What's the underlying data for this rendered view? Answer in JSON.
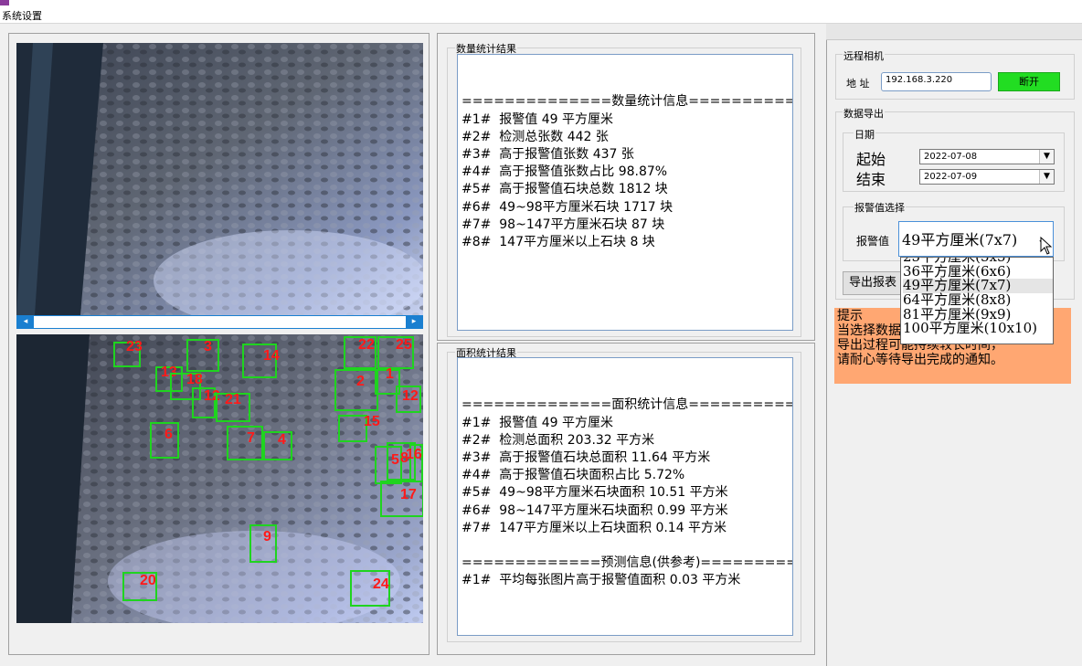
{
  "menu": {
    "settings": "系统设置"
  },
  "count_panel": {
    "title": "数量统计结果",
    "lines": [
      "==============数量统计信息==============",
      "#1#  报警值 49 平方厘米",
      "#2#  检测总张数 442 张",
      "#3#  高于报警值张数 437 张",
      "#4#  高于报警值张数占比 98.87%",
      "#5#  高于报警值石块总数 1812 块",
      "#6#  49~98平方厘米石块 1717 块",
      "#7#  98~147平方厘米石块 87 块",
      "#8#  147平方厘米以上石块 8 块"
    ]
  },
  "area_panel": {
    "title": "面积统计结果",
    "lines": [
      "==============面积统计信息==============",
      "#1#  报警值 49 平方厘米",
      "#2#  检测总面积 203.32 平方米",
      "#3#  高于报警值石块总面积 11.64 平方米",
      "#4#  高于报警值石块面积占比 5.72%",
      "#5#  49~98平方厘米石块面积 10.51 平方米",
      "#6#  98~147平方厘米石块面积 0.99 平方米",
      "#7#  147平方厘米以上石块面积 0.14 平方米",
      "",
      "=============预测信息(供参考)============",
      "#1#  平均每张图片高于报警值面积 0.03 平方米"
    ]
  },
  "camera": {
    "group": "远程相机",
    "address_label": "地 址",
    "address_value": "192.168.3.220",
    "disconnect": "断开"
  },
  "export": {
    "group": "数据导出",
    "date_group": "日期",
    "start_label": "起始",
    "start_value": "2022-07-08",
    "end_label": "结束",
    "end_value": "2022-07-09",
    "alarm_group": "报警值选择",
    "alarm_label": "报警值",
    "alarm_selected": "49平方厘米(7x7)",
    "options": [
      "25平方厘米(5x5)",
      "36平方厘米(6x6)",
      "49平方厘米(7x7)",
      "64平方厘米(8x8)",
      "81平方厘米(9x9)",
      "100平方厘米(10x10)"
    ],
    "export_button": "导出报表"
  },
  "hint": {
    "title": "提示",
    "lines": [
      "当选择数据导出时",
      "导出过程可能持续较长时间，",
      "请耐心等待导出完成的通知。"
    ]
  },
  "detections": [
    "23",
    "3",
    "14",
    "22",
    "25",
    "13",
    "18",
    "12",
    "1",
    "12",
    "21",
    "15",
    "6",
    "7",
    "4",
    "5",
    "8",
    "16",
    "17",
    "9",
    "20",
    "24",
    "2"
  ],
  "colors": {
    "box": "#1fd41f",
    "label": "#ff1a1a",
    "disconnect": "#22dd22",
    "hint_bg": "#ffa772"
  }
}
